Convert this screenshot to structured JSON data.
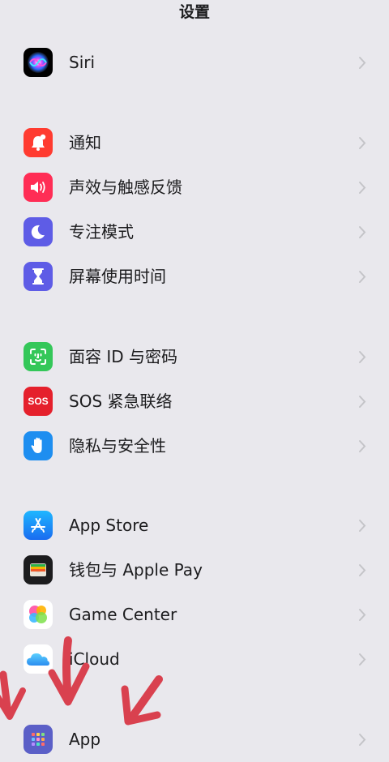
{
  "header": {
    "title": "设置"
  },
  "rows": [
    {
      "id": "siri",
      "label": "Siri"
    },
    {
      "id": "notifications",
      "label": "通知"
    },
    {
      "id": "sounds",
      "label": "声效与触感反馈"
    },
    {
      "id": "focus",
      "label": "专注模式"
    },
    {
      "id": "screentime",
      "label": "屏幕使用时间"
    },
    {
      "id": "faceid",
      "label": "面容 ID 与密码"
    },
    {
      "id": "sos",
      "label": "SOS 紧急联络",
      "icon_text": "SOS"
    },
    {
      "id": "privacy",
      "label": "隐私与安全性"
    },
    {
      "id": "appstore",
      "label": "App Store"
    },
    {
      "id": "wallet",
      "label": "钱包与 Apple Pay"
    },
    {
      "id": "gamecenter",
      "label": "Game Center"
    },
    {
      "id": "icloud",
      "label": "iCloud"
    },
    {
      "id": "apps",
      "label": "App"
    }
  ],
  "icons": {
    "siri": "siri-icon",
    "notifications": "bell-icon",
    "sounds": "speaker-icon",
    "focus": "moon-icon",
    "screentime": "hourglass-icon",
    "faceid": "face-id-icon",
    "sos": "sos-icon",
    "privacy": "hand-icon",
    "appstore": "app-store-icon",
    "wallet": "wallet-icon",
    "gamecenter": "game-center-icon",
    "icloud": "cloud-icon",
    "apps": "app-grid-icon"
  },
  "colors": {
    "background": "#e9e8ed",
    "chevron": "#c4c4c8",
    "notifications": "#ff3b30",
    "sounds": "#ff2d55",
    "focus": "#5e5ce6",
    "screentime": "#5e5ce6",
    "faceid": "#34c759",
    "sos": "#e5202c",
    "privacy": "#1e8ef0",
    "appstore": "#1a8cff",
    "wallet": "#1c1c1e",
    "apps": "#5b5fc7",
    "annotation_arrows": "#d9414f"
  }
}
